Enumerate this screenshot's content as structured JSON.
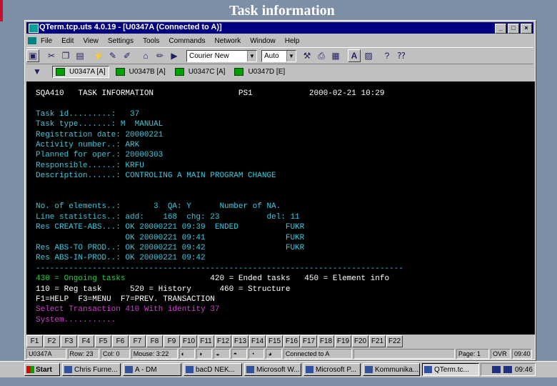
{
  "slide": {
    "title": "Task information"
  },
  "window": {
    "title": "QTerm.tcp.uts 4.0.19 - [U0347A (Connected to A)]",
    "controls": [
      "_",
      "□",
      "×"
    ]
  },
  "menu": [
    "File",
    "Edit",
    "View",
    "Settings",
    "Tools",
    "Commands",
    "Network",
    "Window",
    "Help"
  ],
  "toolbar": {
    "font_combo": "Courier New",
    "size_combo": "Auto",
    "text_button": "A"
  },
  "sessions": [
    {
      "label": "U0347A [A]",
      "active": true
    },
    {
      "label": "U0347B [A]",
      "active": false
    },
    {
      "label": "U0347C [A]",
      "active": false
    },
    {
      "label": "U0347D [E]",
      "active": false
    }
  ],
  "colors": {
    "white": "#ffffff",
    "cyan": "#3cc8dc",
    "green": "#22cc44",
    "magenta": "#d040d0"
  },
  "terminal": {
    "lines": [
      {
        "text": "SQA410   TASK INFORMATION                  PS1            2000-02-21 10:29",
        "color": "white"
      },
      {
        "text": "",
        "color": "white"
      },
      {
        "text": "Task id.........:   37",
        "color": "cyan"
      },
      {
        "text": "Task type.......: M  MANUAL",
        "color": "cyan"
      },
      {
        "text": "Registration date: 20000221",
        "color": "cyan"
      },
      {
        "text": "Activity number..: ARK",
        "color": "cyan"
      },
      {
        "text": "Planned for oper.: 20000303",
        "color": "cyan"
      },
      {
        "text": "Responsible......: KRFU",
        "color": "cyan"
      },
      {
        "text": "Description......: CONTROLING A MAIN PROGRAM CHANGE",
        "color": "cyan"
      },
      {
        "text": "",
        "color": "white"
      },
      {
        "text": "",
        "color": "white"
      },
      {
        "text": "No. of elements..:       3  QA: Y      Number of NA.",
        "color": "cyan"
      },
      {
        "text": "Line statistics..: add:    168  chg: 23          del: 11",
        "color": "cyan"
      },
      {
        "text": "Res CREATE-ABS...: OK 20000221 09:39  ENDED          FUKR",
        "color": "cyan"
      },
      {
        "text": "                   OK 20000221 09:41                 FUKR",
        "color": "cyan"
      },
      {
        "text": "Res ABS-TO PROD..: OK 20000221 09:42                 FUKR",
        "color": "cyan"
      },
      {
        "text": "Res ABS-IN-PROD..: OK 20000221 09:42",
        "color": "cyan"
      },
      {
        "text": "------------------------------------------------------------------------------",
        "color": "cyan"
      },
      {
        "text": "430 = Ongoing tasks                  420 = Ended tasks   450 = Element info",
        "color": "green",
        "split": {
          "at": 37,
          "rest_color": "white"
        }
      },
      {
        "text": "110 = Reg task      520 = History      460 = Structure",
        "color": "white"
      },
      {
        "text": "F1=HELP  F3=MENU  F7=PREV. TRANSACTION",
        "color": "white"
      },
      {
        "text": "Select Transaction 410 With identity 37",
        "color": "magenta"
      },
      {
        "text": "System...........",
        "color": "magenta"
      }
    ]
  },
  "fkeys": [
    "F1",
    "F2",
    "F3",
    "F4",
    "F5",
    "F6",
    "F7",
    "F8",
    "F9",
    "F10",
    "F11",
    "F12",
    "F13",
    "F14",
    "F15",
    "F16",
    "F17",
    "F18",
    "F19",
    "F20",
    "F21",
    "F22"
  ],
  "status": {
    "session": "U0347A",
    "row": "Row: 23",
    "col": "Col: 0",
    "mouse": "Mouse: 3:22",
    "connection": "Connected to A",
    "page": "Page: 1",
    "ovr": "OVR",
    "time": "09:40"
  },
  "taskbar": {
    "start": "Start",
    "tasks": [
      {
        "label": "Chris Furne...",
        "active": false
      },
      {
        "label": "A - DM",
        "active": false
      },
      {
        "label": "bacD NEK...",
        "active": false
      },
      {
        "label": "Microsoft W...",
        "active": false
      },
      {
        "label": "Microsoft P...",
        "active": false
      },
      {
        "label": "Kommunika...",
        "active": false
      },
      {
        "label": "QTerm.tc...",
        "active": true
      }
    ],
    "clock": "09:46"
  }
}
